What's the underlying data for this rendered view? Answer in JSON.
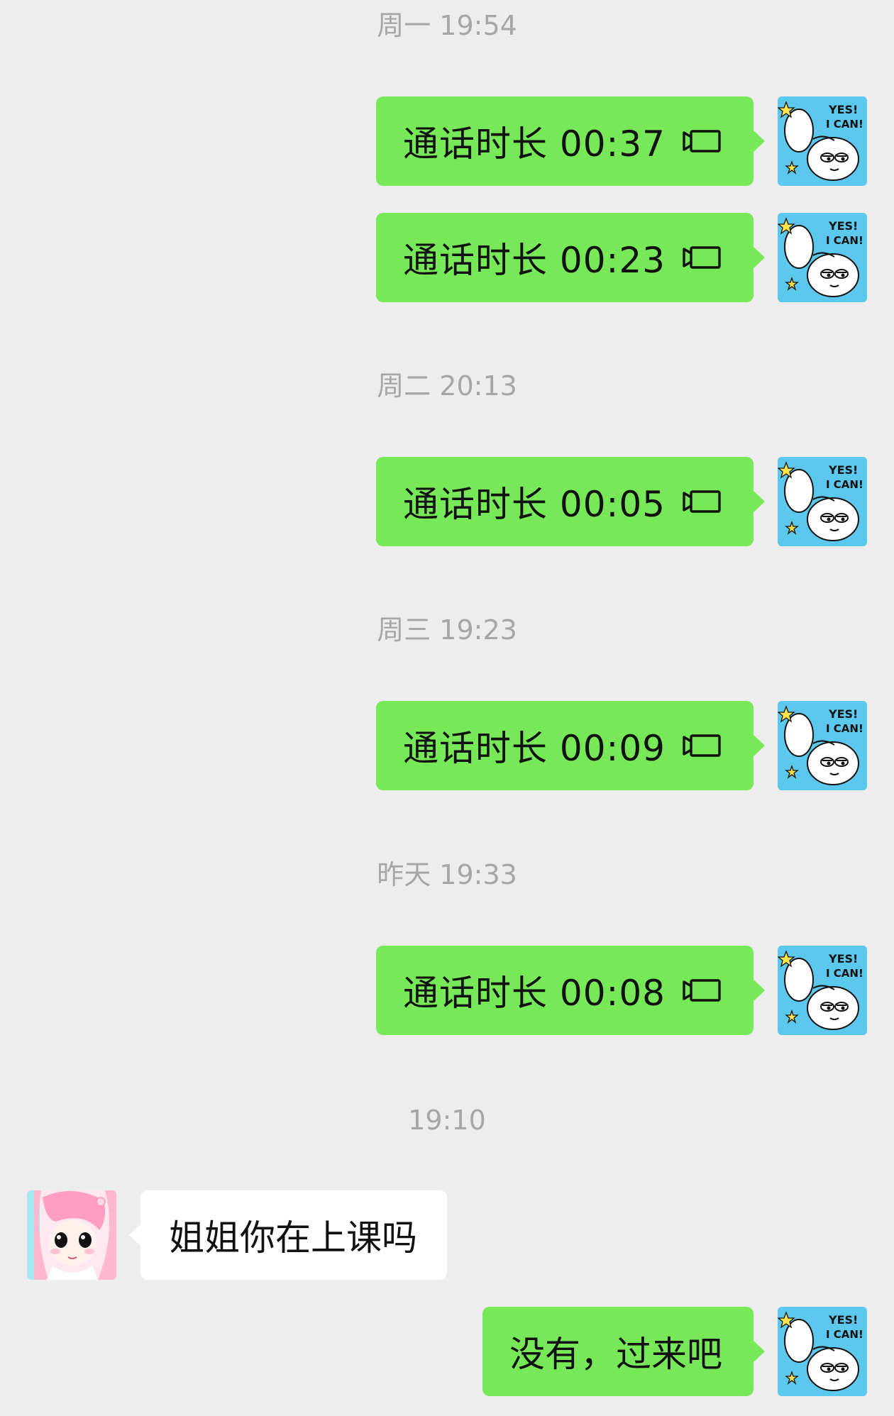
{
  "colors": {
    "background": "#ededed",
    "sent_bubble": "#77e857",
    "received_bubble": "#ffffff",
    "timestamp_text": "#a6a6a6"
  },
  "timestamps": [
    "周一 19:54",
    "周二 20:13",
    "周三 19:23",
    "昨天 19:33",
    "19:10"
  ],
  "messages": [
    {
      "direction": "sent",
      "type": "video-call",
      "text": "通话时长 00:37",
      "icon": "video-camera-icon",
      "avatar": "cartoon-yes-i-can-avatar"
    },
    {
      "direction": "sent",
      "type": "video-call",
      "text": "通话时长 00:23",
      "icon": "video-camera-icon",
      "avatar": "cartoon-yes-i-can-avatar"
    },
    {
      "direction": "sent",
      "type": "video-call",
      "text": "通话时长 00:05",
      "icon": "video-camera-icon",
      "avatar": "cartoon-yes-i-can-avatar"
    },
    {
      "direction": "sent",
      "type": "video-call",
      "text": "通话时长 00:09",
      "icon": "video-camera-icon",
      "avatar": "cartoon-yes-i-can-avatar"
    },
    {
      "direction": "sent",
      "type": "video-call",
      "text": "通话时长 00:08",
      "icon": "video-camera-icon",
      "avatar": "cartoon-yes-i-can-avatar"
    },
    {
      "direction": "received",
      "type": "text",
      "text": "姐姐你在上课吗",
      "avatar": "pink-hair-girl-avatar"
    },
    {
      "direction": "sent",
      "type": "text",
      "text": "没有，过来吧",
      "avatar": "cartoon-yes-i-can-avatar"
    }
  ],
  "avatar_art": {
    "line1": "YES!",
    "line2": "I CAN!"
  }
}
